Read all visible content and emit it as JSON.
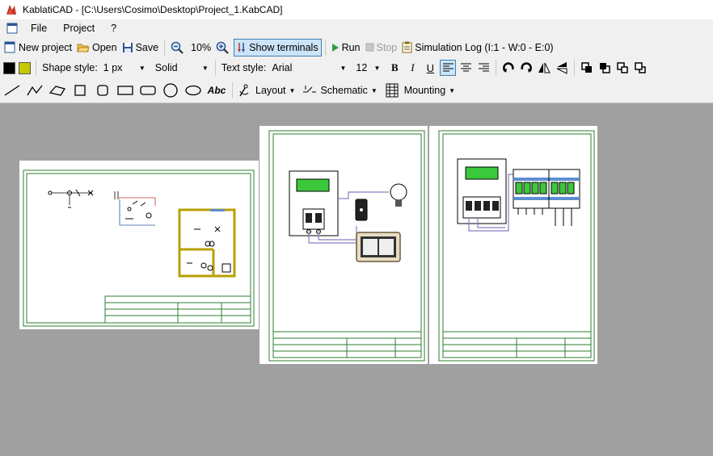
{
  "window": {
    "title": "KablatiCAD - [C:\\Users\\Cosimo\\Desktop\\Project_1.KabCAD]"
  },
  "menu": {
    "file": "File",
    "project": "Project",
    "help": "?"
  },
  "toolbar": {
    "new_project": "New project",
    "open": "Open",
    "save": "Save",
    "zoom_level": "10%",
    "show_terminals": "Show terminals",
    "run": "Run",
    "stop": "Stop",
    "simulation_log": "Simulation Log (I:1 - W:0 - E:0)"
  },
  "format_bar": {
    "shape_style_label": "Shape style:",
    "line_width": "1 px",
    "line_style": "Solid",
    "text_style_label": "Text style:",
    "font_name": "Arial",
    "font_size": "12",
    "bold": "B",
    "italic": "I",
    "underline": "U",
    "fill_color": "#000000",
    "line_color": "#c8c800"
  },
  "draw_bar": {
    "text_tool": "Abc",
    "layout": "Layout",
    "schematic": "Schematic",
    "mounting": "Mounting"
  },
  "colors": {
    "sheet_border": "#2e7d32",
    "canvas_bg": "#a0a0a0",
    "active_button_bg": "#cce4f7",
    "active_button_border": "#3c7fb1",
    "wall": "#b8a000",
    "display_green": "#3cc83c"
  }
}
